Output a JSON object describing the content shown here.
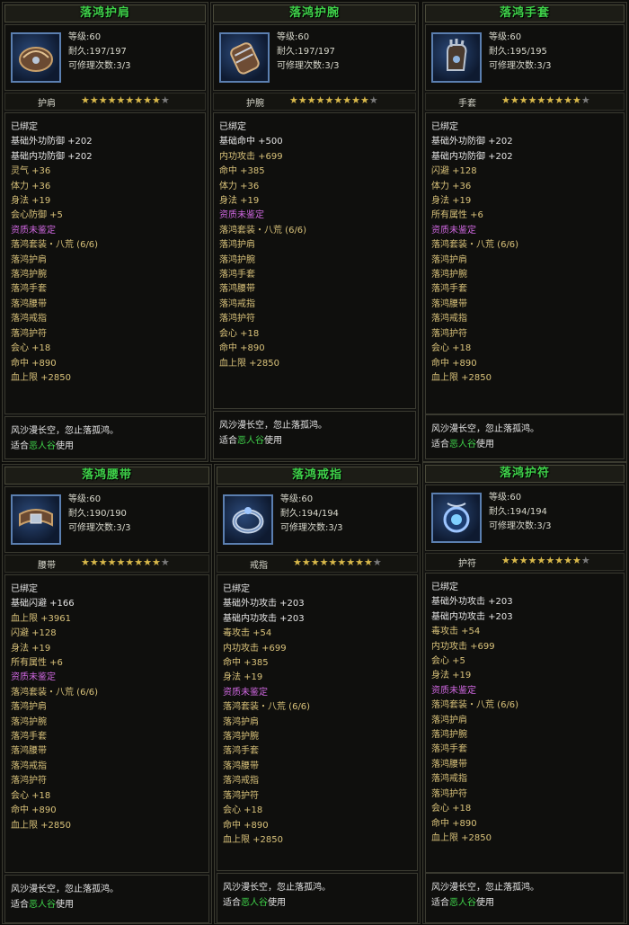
{
  "items": [
    {
      "title": "落鸿护肩",
      "icon": "shoulder-guard-icon",
      "level_label": "等级",
      "level": ":60",
      "dur_label": "耐久",
      "durability": ":197/197",
      "repair_label": "可修理次数",
      "repair": ":3/3",
      "slot": "护肩",
      "stars_filled": 9,
      "stars_total": 10,
      "bound": "已绑定",
      "stats": [
        {
          "label": "基础外功防御",
          "value": "+202",
          "color": "white"
        },
        {
          "label": "基础内功防御",
          "value": "+202",
          "color": "white"
        },
        {
          "label": "灵气",
          "value": "+36",
          "color": "stat"
        },
        {
          "label": "体力",
          "value": "+36",
          "color": "stat"
        },
        {
          "label": "身法",
          "value": "+19",
          "color": "stat"
        },
        {
          "label": "会心防御",
          "value": "+5",
          "color": "stat"
        },
        {
          "label": "资质未鉴定",
          "value": "",
          "color": "purple"
        },
        {
          "label": "落鸿套装・八荒",
          "value": "(6/6)",
          "color": "yellow"
        },
        {
          "label": "落鸿护肩",
          "value": "",
          "color": "yellow"
        },
        {
          "label": "落鸿护腕",
          "value": "",
          "color": "yellow"
        },
        {
          "label": "落鸿手套",
          "value": "",
          "color": "yellow"
        },
        {
          "label": "落鸿腰带",
          "value": "",
          "color": "yellow"
        },
        {
          "label": "落鸿戒指",
          "value": "",
          "color": "yellow"
        },
        {
          "label": "落鸿护符",
          "value": "",
          "color": "yellow"
        },
        {
          "label": "会心",
          "value": "+18",
          "color": "stat"
        },
        {
          "label": "命中",
          "value": "+890",
          "color": "stat"
        },
        {
          "label": "血上限",
          "value": "+2850",
          "color": "stat"
        }
      ],
      "flavor": "风沙漫长空，忽止落孤鸿。",
      "suit_pre": "适合",
      "suit_school": "恶人谷",
      "suit_post": "使用"
    },
    {
      "title": "落鸿护腕",
      "icon": "bracer-icon",
      "level_label": "等级",
      "level": ":60",
      "dur_label": "耐久",
      "durability": ":197/197",
      "repair_label": "可修理次数",
      "repair": ":3/3",
      "slot": "护腕",
      "stars_filled": 9,
      "stars_total": 10,
      "bound": "已绑定",
      "stats": [
        {
          "label": "基础命中",
          "value": "+500",
          "color": "white"
        },
        {
          "label": "内功攻击",
          "value": "+699",
          "color": "stat"
        },
        {
          "label": "命中",
          "value": "+385",
          "color": "stat"
        },
        {
          "label": "体力",
          "value": "+36",
          "color": "stat"
        },
        {
          "label": "身法",
          "value": "+19",
          "color": "stat"
        },
        {
          "label": "资质未鉴定",
          "value": "",
          "color": "purple"
        },
        {
          "label": "落鸿套装・八荒",
          "value": "(6/6)",
          "color": "yellow"
        },
        {
          "label": "落鸿护肩",
          "value": "",
          "color": "yellow"
        },
        {
          "label": "落鸿护腕",
          "value": "",
          "color": "yellow"
        },
        {
          "label": "落鸿手套",
          "value": "",
          "color": "yellow"
        },
        {
          "label": "落鸿腰带",
          "value": "",
          "color": "yellow"
        },
        {
          "label": "落鸿戒指",
          "value": "",
          "color": "yellow"
        },
        {
          "label": "落鸿护符",
          "value": "",
          "color": "yellow"
        },
        {
          "label": "会心",
          "value": "+18",
          "color": "stat"
        },
        {
          "label": "命中",
          "value": "+890",
          "color": "stat"
        },
        {
          "label": "血上限",
          "value": "+2850",
          "color": "stat"
        }
      ],
      "flavor": "风沙漫长空，忽止落孤鸿。",
      "suit_pre": "适合",
      "suit_school": "恶人谷",
      "suit_post": "使用"
    },
    {
      "title": "落鸿手套",
      "icon": "glove-icon",
      "level_label": "等级",
      "level": ":60",
      "dur_label": "耐久",
      "durability": ":195/195",
      "repair_label": "可修理次数",
      "repair": ":3/3",
      "slot": "手套",
      "stars_filled": 9,
      "stars_total": 10,
      "bound": "已绑定",
      "stats": [
        {
          "label": "基础外功防御",
          "value": "+202",
          "color": "white"
        },
        {
          "label": "基础内功防御",
          "value": "+202",
          "color": "white"
        },
        {
          "label": "闪避",
          "value": "+128",
          "color": "stat"
        },
        {
          "label": "体力",
          "value": "+36",
          "color": "stat"
        },
        {
          "label": "身法",
          "value": "+19",
          "color": "stat"
        },
        {
          "label": "所有属性",
          "value": "+6",
          "color": "stat"
        },
        {
          "label": "资质未鉴定",
          "value": "",
          "color": "purple"
        },
        {
          "label": "落鸿套装・八荒",
          "value": "(6/6)",
          "color": "yellow"
        },
        {
          "label": "落鸿护肩",
          "value": "",
          "color": "yellow"
        },
        {
          "label": "落鸿护腕",
          "value": "",
          "color": "yellow"
        },
        {
          "label": "落鸿手套",
          "value": "",
          "color": "yellow"
        },
        {
          "label": "落鸿腰带",
          "value": "",
          "color": "yellow"
        },
        {
          "label": "落鸿戒指",
          "value": "",
          "color": "yellow"
        },
        {
          "label": "落鸿护符",
          "value": "",
          "color": "yellow"
        },
        {
          "label": "会心",
          "value": "+18",
          "color": "stat"
        },
        {
          "label": "命中",
          "value": "+890",
          "color": "stat"
        },
        {
          "label": "血上限",
          "value": "+2850",
          "color": "stat"
        }
      ],
      "flavor": "风沙漫长空，忽止落孤鸿。",
      "suit_pre": "适合",
      "suit_school": "恶人谷",
      "suit_post": "使用"
    },
    {
      "title": "落鸿腰带",
      "icon": "belt-icon",
      "level_label": "等级",
      "level": ":60",
      "dur_label": "耐久",
      "durability": ":190/190",
      "repair_label": "可修理次数",
      "repair": ":3/3",
      "slot": "腰带",
      "stars_filled": 9,
      "stars_total": 10,
      "bound": "已绑定",
      "stats": [
        {
          "label": "基础闪避",
          "value": "+166",
          "color": "white"
        },
        {
          "label": "血上限",
          "value": "+3961",
          "color": "stat"
        },
        {
          "label": "闪避",
          "value": "+128",
          "color": "stat"
        },
        {
          "label": "身法",
          "value": "+19",
          "color": "stat"
        },
        {
          "label": "所有属性",
          "value": "+6",
          "color": "stat"
        },
        {
          "label": "资质未鉴定",
          "value": "",
          "color": "purple"
        },
        {
          "label": "落鸿套装・八荒",
          "value": "(6/6)",
          "color": "yellow"
        },
        {
          "label": "落鸿护肩",
          "value": "",
          "color": "yellow"
        },
        {
          "label": "落鸿护腕",
          "value": "",
          "color": "yellow"
        },
        {
          "label": "落鸿手套",
          "value": "",
          "color": "yellow"
        },
        {
          "label": "落鸿腰带",
          "value": "",
          "color": "yellow"
        },
        {
          "label": "落鸿戒指",
          "value": "",
          "color": "yellow"
        },
        {
          "label": "落鸿护符",
          "value": "",
          "color": "yellow"
        },
        {
          "label": "会心",
          "value": "+18",
          "color": "stat"
        },
        {
          "label": "命中",
          "value": "+890",
          "color": "stat"
        },
        {
          "label": "血上限",
          "value": "+2850",
          "color": "stat"
        }
      ],
      "flavor": "风沙漫长空，忽止落孤鸿。",
      "suit_pre": "适合",
      "suit_school": "恶人谷",
      "suit_post": "使用"
    },
    {
      "title": "落鸿戒指",
      "icon": "ring-icon",
      "level_label": "等级",
      "level": ":60",
      "dur_label": "耐久",
      "durability": ":194/194",
      "repair_label": "可修理次数",
      "repair": ":3/3",
      "slot": "戒指",
      "stars_filled": 9,
      "stars_total": 10,
      "bound": "已绑定",
      "stats": [
        {
          "label": "基础外功攻击",
          "value": "+203",
          "color": "white"
        },
        {
          "label": "基础内功攻击",
          "value": "+203",
          "color": "white"
        },
        {
          "label": "毒攻击",
          "value": "+54",
          "color": "stat"
        },
        {
          "label": "内功攻击",
          "value": "+699",
          "color": "stat"
        },
        {
          "label": "命中",
          "value": "+385",
          "color": "stat"
        },
        {
          "label": "身法",
          "value": "+19",
          "color": "stat"
        },
        {
          "label": "资质未鉴定",
          "value": "",
          "color": "purple"
        },
        {
          "label": "落鸿套装・八荒",
          "value": "(6/6)",
          "color": "yellow"
        },
        {
          "label": "落鸿护肩",
          "value": "",
          "color": "yellow"
        },
        {
          "label": "落鸿护腕",
          "value": "",
          "color": "yellow"
        },
        {
          "label": "落鸿手套",
          "value": "",
          "color": "yellow"
        },
        {
          "label": "落鸿腰带",
          "value": "",
          "color": "yellow"
        },
        {
          "label": "落鸿戒指",
          "value": "",
          "color": "yellow"
        },
        {
          "label": "落鸿护符",
          "value": "",
          "color": "yellow"
        },
        {
          "label": "会心",
          "value": "+18",
          "color": "stat"
        },
        {
          "label": "命中",
          "value": "+890",
          "color": "stat"
        },
        {
          "label": "血上限",
          "value": "+2850",
          "color": "stat"
        }
      ],
      "flavor": "风沙漫长空，忽止落孤鸿。",
      "suit_pre": "适合",
      "suit_school": "恶人谷",
      "suit_post": "使用"
    },
    {
      "title": "落鸿护符",
      "icon": "amulet-icon",
      "level_label": "等级",
      "level": ":60",
      "dur_label": "耐久",
      "durability": ":194/194",
      "repair_label": "可修理次数",
      "repair": ":3/3",
      "slot": "护符",
      "stars_filled": 9,
      "stars_total": 10,
      "bound": "已绑定",
      "stats": [
        {
          "label": "基础外功攻击",
          "value": "+203",
          "color": "white"
        },
        {
          "label": "基础内功攻击",
          "value": "+203",
          "color": "white"
        },
        {
          "label": "毒攻击",
          "value": "+54",
          "color": "stat"
        },
        {
          "label": "内功攻击",
          "value": "+699",
          "color": "stat"
        },
        {
          "label": "会心",
          "value": "+5",
          "color": "stat"
        },
        {
          "label": "身法",
          "value": "+19",
          "color": "stat"
        },
        {
          "label": "资质未鉴定",
          "value": "",
          "color": "purple"
        },
        {
          "label": "落鸿套装・八荒",
          "value": "(6/6)",
          "color": "yellow"
        },
        {
          "label": "落鸿护肩",
          "value": "",
          "color": "yellow"
        },
        {
          "label": "落鸿护腕",
          "value": "",
          "color": "yellow"
        },
        {
          "label": "落鸿手套",
          "value": "",
          "color": "yellow"
        },
        {
          "label": "落鸿腰带",
          "value": "",
          "color": "yellow"
        },
        {
          "label": "落鸿戒指",
          "value": "",
          "color": "yellow"
        },
        {
          "label": "落鸿护符",
          "value": "",
          "color": "yellow"
        },
        {
          "label": "会心",
          "value": "+18",
          "color": "stat"
        },
        {
          "label": "命中",
          "value": "+890",
          "color": "stat"
        },
        {
          "label": "血上限",
          "value": "+2850",
          "color": "stat"
        }
      ],
      "flavor": "风沙漫长空，忽止落孤鸿。",
      "suit_pre": "适合",
      "suit_school": "恶人谷",
      "suit_post": "使用"
    }
  ]
}
